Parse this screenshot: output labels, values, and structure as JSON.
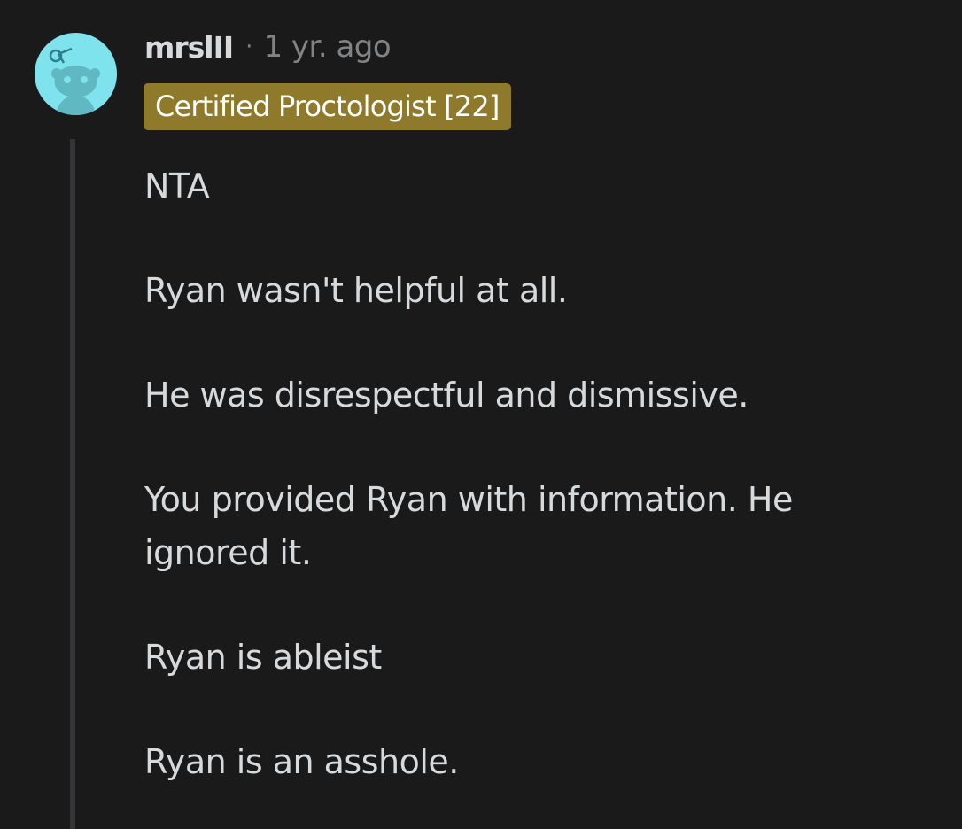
{
  "comment": {
    "author": "mrslII",
    "separator": "·",
    "timestamp": "1 yr. ago",
    "flair": "Certified Proctologist [22]",
    "paragraphs": [
      "NTA",
      "Ryan wasn't helpful at all.",
      "He was disrespectful and dismissive.",
      "You provided Ryan with information. He ignored it.",
      "Ryan is ableist",
      "Ryan is an asshole."
    ]
  },
  "colors": {
    "background": "#1a1a1b",
    "avatar_bg": "#7fe3ee",
    "flair_bg": "#8f7a2b",
    "text": "#d7dadc",
    "muted": "#818384",
    "thread_line": "#343536"
  },
  "icons": {
    "avatar": "reddit-snoo-avatar-icon"
  }
}
